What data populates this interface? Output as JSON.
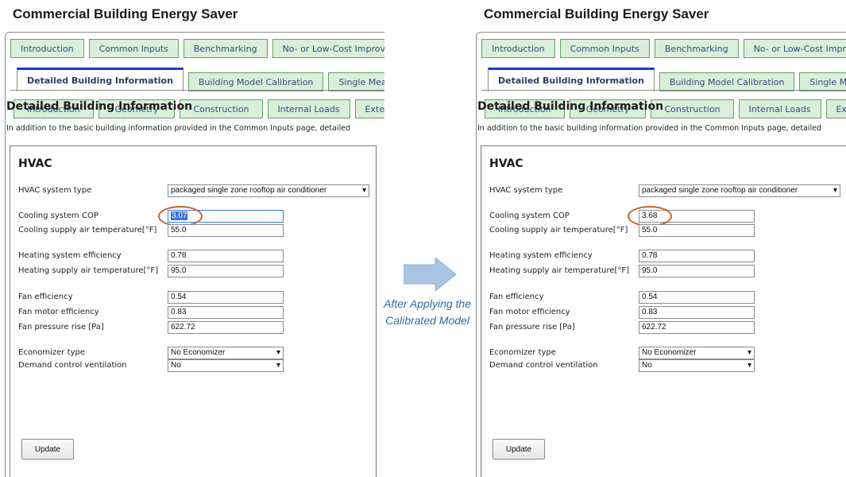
{
  "app_title": "Commercial Building Energy Saver",
  "top_tabs": [
    "Introduction",
    "Common Inputs",
    "Benchmarking",
    "No- or Low-Cost Improvements"
  ],
  "sub_tabs": [
    "Detailed Building Information",
    "Building Model Calibration",
    "Single Measure Analysis"
  ],
  "detail_tabs": [
    "Introduction",
    "Geometry",
    "Construction",
    "Internal Loads",
    "Exterior"
  ],
  "section_heading": "Detailed Building Information",
  "intro_text": "In addition to the basic building information provided in the Common Inputs page, detailed",
  "hvac": {
    "title": "HVAC",
    "labels": {
      "system_type": "HVAC system type",
      "cooling_cop": "Cooling system COP",
      "cooling_supply": "Cooling supply air temperature[°F]",
      "heating_eff": "Heating system efficiency",
      "heating_supply": "Heating supply air temperature[°F]",
      "fan_eff": "Fan efficiency",
      "fan_motor_eff": "Fan motor efficiency",
      "fan_pressure": "Fan pressure rise [Pa]",
      "economizer": "Economizer type",
      "dcv": "Demand control ventilation"
    },
    "update_label": "Update"
  },
  "before": {
    "system_type": "packaged single zone rooftop air conditioner",
    "cooling_cop": "3.07",
    "cooling_supply": "55.0",
    "heating_eff": "0.78",
    "heating_supply": "95.0",
    "fan_eff": "0.54",
    "fan_motor_eff": "0.83",
    "fan_pressure": "622.72",
    "economizer": "No Economizer",
    "dcv": "No"
  },
  "after": {
    "system_type": "packaged single zone rooftop air conditioner",
    "cooling_cop": "3.68",
    "cooling_supply": "55.0",
    "heating_eff": "0.78",
    "heating_supply": "95.0",
    "fan_eff": "0.54",
    "fan_motor_eff": "0.83",
    "fan_pressure": "622.72",
    "economizer": "No Economizer",
    "dcv": "No"
  },
  "caption": "After Applying the Calibrated Model",
  "colors": {
    "tab_fill": "#d9efd9",
    "tab_border": "#5fa55f",
    "active_tab_accent": "#1a3cc8",
    "highlight_ring": "#c4652f",
    "arrow": "#a9c4e4",
    "caption": "#2d6da3"
  }
}
